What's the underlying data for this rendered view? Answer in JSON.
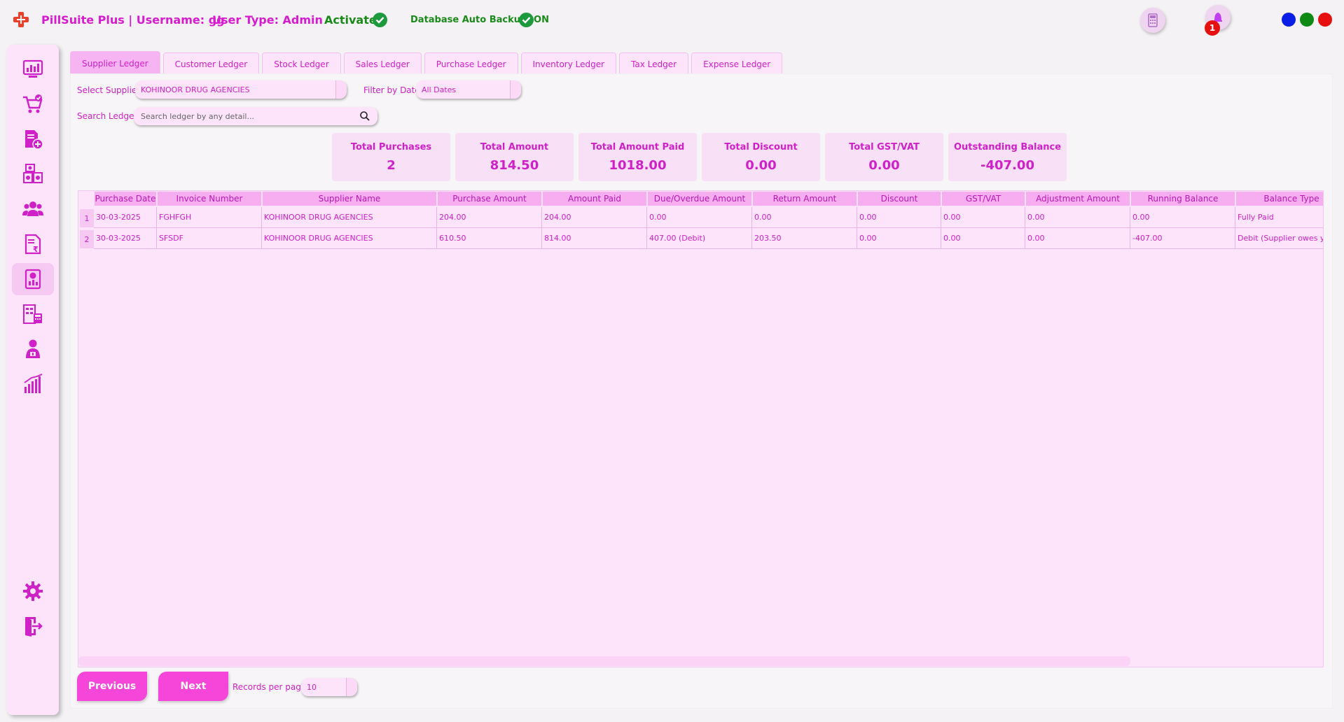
{
  "header": {
    "title": "PillSuite Plus | Username: gg",
    "user_type": "User Type: Admin",
    "activation_status": "Activated",
    "backup_status": "Database Auto Backup: ON",
    "notification_count": "1",
    "window_dots": [
      "#0a1ee6",
      "#0d8a14",
      "#e61010"
    ],
    "icons": [
      "logo-cross-icon",
      "calculator-icon",
      "bell-icon"
    ]
  },
  "sidebar": {
    "items": [
      {
        "name": "dashboard",
        "icon": "dashboard-icon"
      },
      {
        "name": "sales",
        "icon": "cart-icon"
      },
      {
        "name": "add-product",
        "icon": "add-document-icon"
      },
      {
        "name": "inventory",
        "icon": "boxes-icon"
      },
      {
        "name": "customers",
        "icon": "people-icon"
      },
      {
        "name": "invoices",
        "icon": "rupee-invoice-icon"
      },
      {
        "name": "ledger",
        "icon": "ledger-book-icon",
        "active": true
      },
      {
        "name": "reports",
        "icon": "building-calculator-icon"
      },
      {
        "name": "users",
        "icon": "user-icon"
      },
      {
        "name": "analytics",
        "icon": "bar-chart-icon"
      }
    ],
    "bottom_items": [
      {
        "name": "settings",
        "icon": "gear-icon"
      },
      {
        "name": "logout",
        "icon": "exit-icon"
      }
    ]
  },
  "tabs": [
    "Supplier Ledger",
    "Customer Ledger",
    "Stock Ledger",
    "Sales Ledger",
    "Purchase Ledger",
    "Inventory Ledger",
    "Tax Ledger",
    "Expense Ledger"
  ],
  "filters": {
    "supplier_label": "Select Supplier",
    "supplier_value": "KOHINOOR DRUG AGENCIES",
    "date_label": "Filter by Date",
    "date_value": "All Dates",
    "search_label": "Search Ledger",
    "search_placeholder": "Search ledger by any detail..."
  },
  "summary": [
    {
      "title": "Total Purchases",
      "value": "2"
    },
    {
      "title": "Total Amount",
      "value": "814.50"
    },
    {
      "title": "Total Amount Paid",
      "value": "1018.00"
    },
    {
      "title": "Total Discount",
      "value": "0.00"
    },
    {
      "title": "Total GST/VAT",
      "value": "0.00"
    },
    {
      "title": "Outstanding Balance",
      "value": "-407.00"
    }
  ],
  "table": {
    "columns": [
      "Purchase Date",
      "Invoice Number",
      "Supplier Name",
      "Purchase Amount",
      "Amount Paid",
      "Due/Overdue Amount",
      "Return Amount",
      "Discount",
      "GST/VAT",
      "Adjustment Amount",
      "Running Balance",
      "Balance Type"
    ],
    "rows": [
      {
        "num": "1",
        "cells": [
          "30-03-2025",
          "FGHFGH",
          "KOHINOOR DRUG AGENCIES",
          "204.00",
          "204.00",
          "0.00",
          "0.00",
          "0.00",
          "0.00",
          "0.00",
          "0.00",
          "Fully Paid"
        ]
      },
      {
        "num": "2",
        "cells": [
          "30-03-2025",
          "SFSDF",
          "KOHINOOR DRUG AGENCIES",
          "610.50",
          "814.00",
          "407.00 (Debit)",
          "203.50",
          "0.00",
          "0.00",
          "0.00",
          "-407.00",
          "Debit (Supplier owes you)"
        ]
      }
    ]
  },
  "footer": {
    "previous_label": "Previous",
    "next_label": "Next",
    "records_label": "Records per page",
    "records_value": "10"
  }
}
